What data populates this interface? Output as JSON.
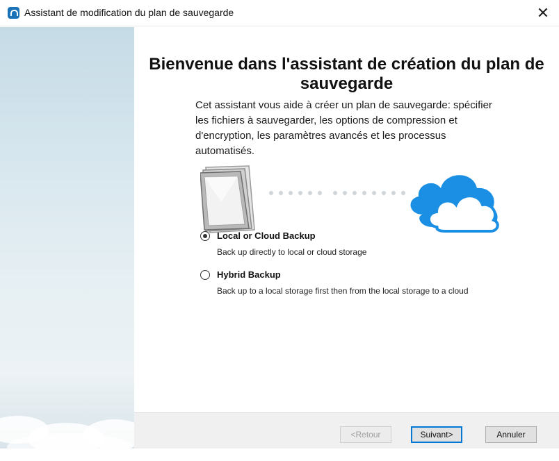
{
  "window": {
    "title": "Assistant de modification du plan de sauvegarde",
    "close_glyph": "✕"
  },
  "main": {
    "heading": "Bienvenue dans l'assistant de création du plan de sauvegarde",
    "intro": "Cet assistant vous aide à créer un plan de sauvegarde: spécifier les fichiers à sauvegarder, les options de compression et d'encryption, les paramètres avancés et les processus automatisés."
  },
  "illustration": {
    "left_icon": "documents-stack-icon",
    "right_icon": "cloud-icon",
    "accent": "#1a8fe3"
  },
  "options": [
    {
      "label": "Local or Cloud Backup",
      "description": "Back up directly to local or cloud storage",
      "selected": true
    },
    {
      "label": "Hybrid Backup",
      "description": "Back up to a local storage first then from the local storage to a cloud",
      "selected": false
    }
  ],
  "footer": {
    "back_label": "<Retour",
    "next_label": "Suivant>",
    "cancel_label": "Annuler"
  }
}
